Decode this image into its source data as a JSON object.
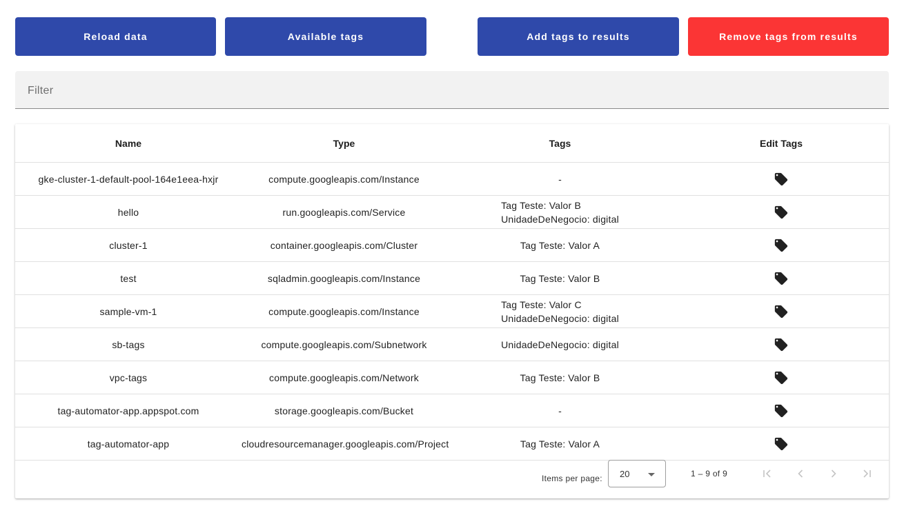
{
  "toolbar": {
    "reload_label": "Reload data",
    "available_tags_label": "Available tags",
    "add_tags_label": "Add tags to results",
    "remove_tags_label": "Remove tags from results"
  },
  "filter": {
    "placeholder": "Filter",
    "value": ""
  },
  "table": {
    "headers": {
      "name": "Name",
      "type": "Type",
      "tags": "Tags",
      "edit": "Edit Tags"
    },
    "rows": [
      {
        "name": "gke-cluster-1-default-pool-164e1eea-hxjr",
        "type": "compute.googleapis.com/Instance",
        "tags": [
          "-"
        ]
      },
      {
        "name": "hello",
        "type": "run.googleapis.com/Service",
        "tags": [
          "Tag Teste: Valor B",
          "UnidadeDeNegocio: digital"
        ]
      },
      {
        "name": "cluster-1",
        "type": "container.googleapis.com/Cluster",
        "tags": [
          "Tag Teste: Valor A"
        ]
      },
      {
        "name": "test",
        "type": "sqladmin.googleapis.com/Instance",
        "tags": [
          "Tag Teste: Valor B"
        ]
      },
      {
        "name": "sample-vm-1",
        "type": "compute.googleapis.com/Instance",
        "tags": [
          "Tag Teste: Valor C",
          "UnidadeDeNegocio: digital"
        ]
      },
      {
        "name": "sb-tags",
        "type": "compute.googleapis.com/Subnetwork",
        "tags": [
          "UnidadeDeNegocio: digital"
        ]
      },
      {
        "name": "vpc-tags",
        "type": "compute.googleapis.com/Network",
        "tags": [
          "Tag Teste: Valor B"
        ]
      },
      {
        "name": "tag-automator-app.appspot.com",
        "type": "storage.googleapis.com/Bucket",
        "tags": [
          "-"
        ]
      },
      {
        "name": "tag-automator-app",
        "type": "cloudresourcemanager.googleapis.com/Project",
        "tags": [
          "Tag Teste: Valor A"
        ]
      }
    ],
    "edit_icon": "tag-icon"
  },
  "paginator": {
    "items_per_page_label": "Items per page:",
    "items_per_page_value": "20",
    "range_label": "1 – 9 of 9",
    "icons": [
      "first-page-icon",
      "previous-page-icon",
      "next-page-icon",
      "last-page-icon"
    ]
  },
  "colors": {
    "primary": "#2f49aa",
    "warn": "#fb3535",
    "filter_bg": "#f2f2f2",
    "icon_dark": "#212121",
    "icon_disabled": "#c4c4c4"
  }
}
